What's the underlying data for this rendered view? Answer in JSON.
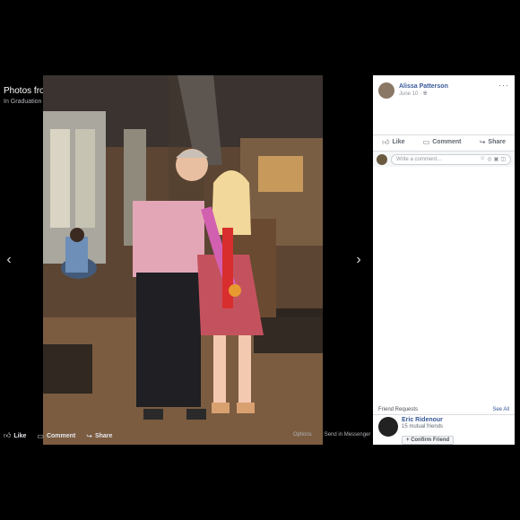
{
  "theater": {
    "title": "Photos from Alissa Patterson's post",
    "album_prefix": "In",
    "album_name": "Graduation",
    "actions": {
      "like": "Like",
      "comment": "Comment",
      "share": "Share"
    },
    "extra": {
      "options": "Options",
      "send": "Send in Messenger"
    },
    "nav": {
      "prev": "‹",
      "next": "›"
    }
  },
  "post": {
    "author": "Alissa Patterson",
    "date": "June 10 ·",
    "privacy_icon": "globe-icon"
  },
  "reactions": {
    "like": "Like",
    "comment": "Comment",
    "share": "Share"
  },
  "comment_box": {
    "placeholder": "Write a comment..."
  },
  "friend_requests": {
    "title": "Friend Requests",
    "see_all": "See All",
    "items": [
      {
        "name": "Eric Ridenour",
        "mutual": "15 mutual friends",
        "confirm": "Confirm Friend"
      }
    ]
  },
  "colors": {
    "link": "#385898",
    "background": "#000000",
    "panel": "#ffffff"
  }
}
